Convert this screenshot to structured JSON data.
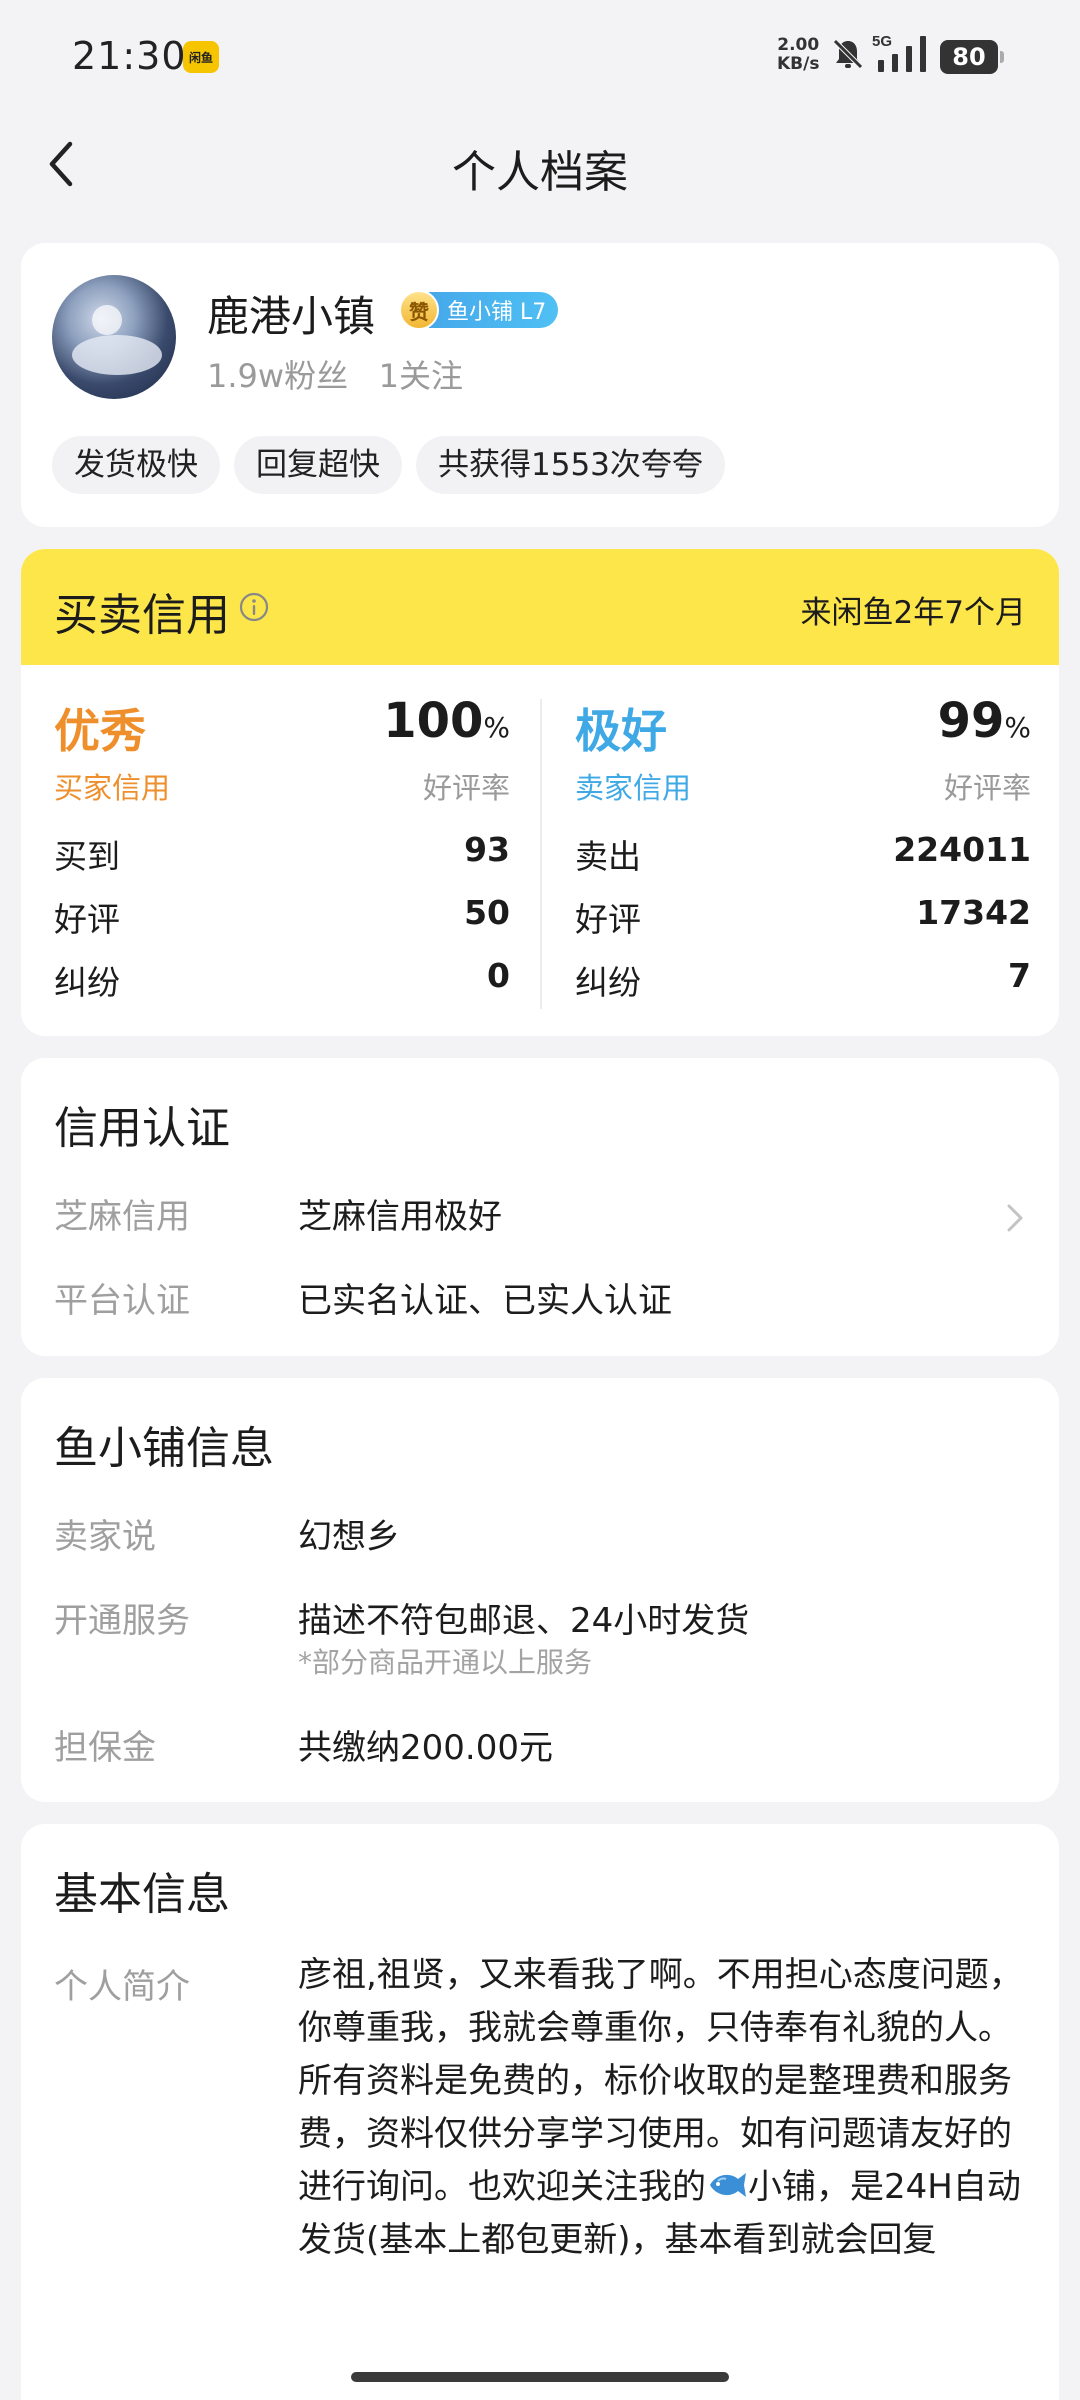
{
  "status_bar": {
    "time": "21:30",
    "app_badge": "闲鱼",
    "net_speed_value": "2.00",
    "net_speed_unit": "KB/s",
    "network": "5G",
    "battery": "80"
  },
  "nav": {
    "title": "个人档案"
  },
  "profile": {
    "name": "鹿港小镇",
    "zan_badge": "赞",
    "level": "鱼小铺 L7",
    "fans": "1.9w粉丝",
    "follows": "1关注",
    "tags": [
      "发货极快",
      "回复超快",
      "共获得1553次夸夸"
    ]
  },
  "credit": {
    "title": "买卖信用",
    "age": "来闲鱼2年7个月",
    "buyer": {
      "grade": "优秀",
      "grade_label": "买家信用",
      "rate": "100",
      "rate_unit": "%",
      "rate_label": "好评率",
      "stats": [
        {
          "label": "买到",
          "value": "93"
        },
        {
          "label": "好评",
          "value": "50"
        },
        {
          "label": "纠纷",
          "value": "0"
        }
      ]
    },
    "seller": {
      "grade": "极好",
      "grade_label": "卖家信用",
      "rate": "99",
      "rate_unit": "%",
      "rate_label": "好评率",
      "stats": [
        {
          "label": "卖出",
          "value": "224011"
        },
        {
          "label": "好评",
          "value": "17342"
        },
        {
          "label": "纠纷",
          "value": "7"
        }
      ]
    },
    "colors": {
      "buyer": "#ee8f2c",
      "seller": "#3fa9e6",
      "header_bg": "#fde64a"
    }
  },
  "auth": {
    "title": "信用认证",
    "rows": [
      {
        "label": "芝麻信用",
        "value": "芝麻信用极好"
      },
      {
        "label": "平台认证",
        "value": "已实名认证、已实人认证"
      }
    ]
  },
  "shop": {
    "title": "鱼小铺信息",
    "rows": [
      {
        "label": "卖家说",
        "value": "幻想乡"
      },
      {
        "label": "开通服务",
        "value": "描述不符包邮退、24小时发货",
        "note": "*部分商品开通以上服务"
      },
      {
        "label": "担保金",
        "value": "共缴纳200.00元"
      }
    ]
  },
  "basic": {
    "title": "基本信息",
    "intro_label": "个人简介",
    "intro_before_icon": "彦祖,祖贤，又来看我了啊。不用担心态度问题，你尊重我，我就会尊重你，只侍奉有礼貌的人。所有资料是免费的，标价收取的是整理费和服务费，资料仅供分享学习使用。如有问题请友好的进行询问。也欢迎关注我的",
    "intro_icon": "fish-icon",
    "intro_after_icon": "小铺，是24H自动发货(基本上都包更新)，基本看到就会回复"
  }
}
